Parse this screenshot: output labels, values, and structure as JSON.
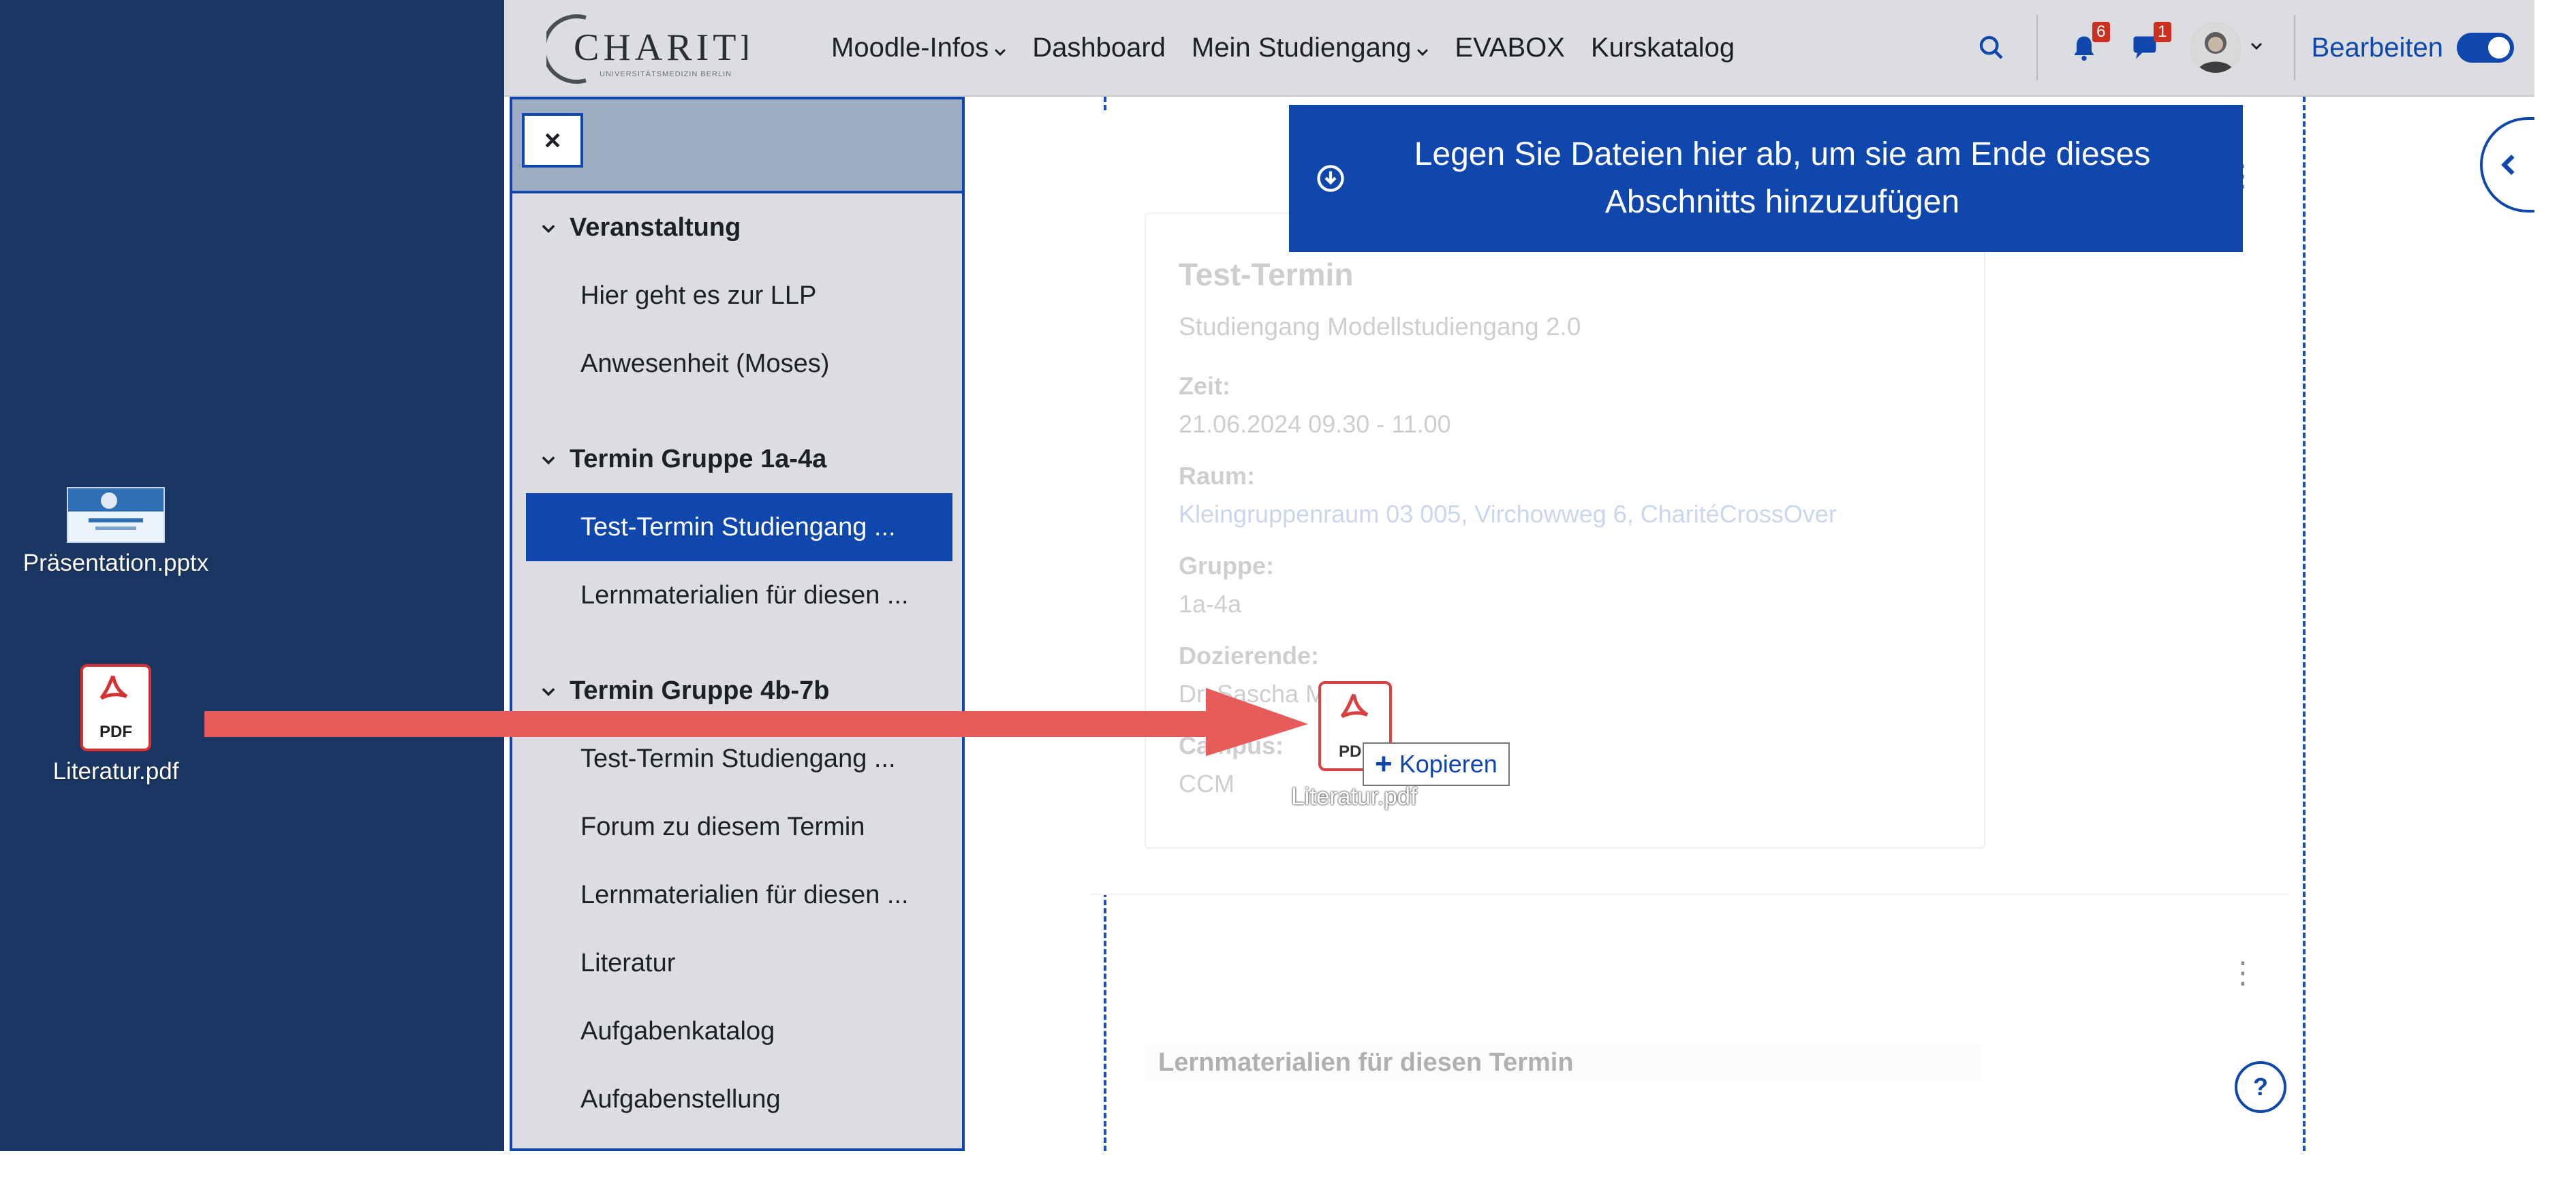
{
  "desktop": {
    "files": [
      {
        "name": "Präsentation.pptx",
        "icon": "pptx-file-icon"
      },
      {
        "name": "Literatur.pdf",
        "icon": "pdf-file-icon",
        "badge": "PDF"
      }
    ]
  },
  "navbar": {
    "logo_text": "CHARITÉ",
    "logo_subtext": "UNIVERSITÄTSMEDIZIN BERLIN",
    "items": [
      {
        "label": "Moodle-Infos",
        "has_dropdown": true
      },
      {
        "label": "Dashboard",
        "has_dropdown": false
      },
      {
        "label": "Mein Studiengang",
        "has_dropdown": true
      },
      {
        "label": "EVABOX",
        "has_dropdown": false
      },
      {
        "label": "Kurskatalog",
        "has_dropdown": false
      }
    ],
    "notifications_count": "6",
    "messages_count": "1",
    "edit_mode_label": "Bearbeiten",
    "edit_mode_on": true,
    "accent_color": "#0f47ad"
  },
  "drawer": {
    "close_label": "×",
    "sections": [
      {
        "title": "Veranstaltung",
        "items": [
          {
            "label": "Hier geht es zur LLP",
            "active": false
          },
          {
            "label": "Anwesenheit (Moses)",
            "active": false
          }
        ]
      },
      {
        "title": "Termin Gruppe 1a-4a",
        "items": [
          {
            "label": "Test-Termin Studiengang ...",
            "active": true
          },
          {
            "label": "Lernmaterialien für diesen ...",
            "active": false
          }
        ]
      },
      {
        "title": "Termin Gruppe 4b-7b",
        "items": [
          {
            "label": "Test-Termin Studiengang ...",
            "active": false
          },
          {
            "label": "Forum zu diesem Termin",
            "active": false
          },
          {
            "label": "Lernmaterialien für diesen ...",
            "active": false
          },
          {
            "label": "Literatur",
            "active": false
          },
          {
            "label": "Aufgabenkatalog",
            "active": false
          },
          {
            "label": "Aufgabenstellung",
            "active": false
          }
        ]
      }
    ]
  },
  "dropzone": {
    "icon": "download-circle-icon",
    "message": "Legen Sie Dateien hier ab, um sie am Ende dieses Abschnitts hinzuzufügen"
  },
  "activity": {
    "title": "Test-Termin",
    "subtitle": "Studiengang Modellstudiengang 2.0",
    "fields": [
      {
        "label": "Zeit:",
        "value": "21.06.2024 09.30 - 11.00",
        "link": false
      },
      {
        "label": "Raum:",
        "value": "Kleingruppenraum 03 005, Virchowweg 6, CharitéCrossOver",
        "link": true
      },
      {
        "label": "Gruppe:",
        "value": "1a-4a",
        "link": false
      },
      {
        "label": "Dozierende:",
        "value": "Dr. Sascha M...",
        "link": false
      },
      {
        "label": "Campus:",
        "value": "CCM",
        "link": false
      }
    ]
  },
  "section2": {
    "title": "Lernmaterialien für diesen Termin"
  },
  "drag": {
    "file_name": "Literatur.pdf",
    "file_badge": "PDF",
    "action_label": "Kopieren"
  },
  "help_label": "?"
}
